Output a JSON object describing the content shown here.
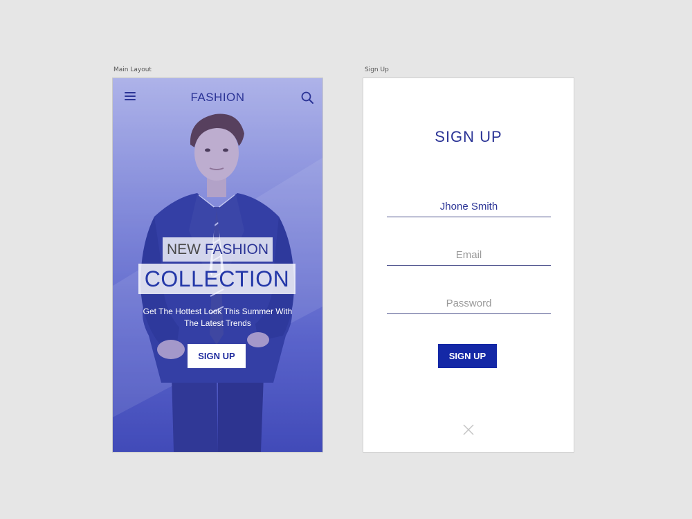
{
  "artboards": {
    "main_label": "Main Layout",
    "signup_label": "Sign Up"
  },
  "main": {
    "menu_icon": "hamburger-menu-icon",
    "brand": "FASHION",
    "search_icon": "search-icon",
    "headline_part1": "NEW ",
    "headline_part2": "FASHION",
    "headline_line2": "COLLECTION",
    "tagline_line1": "Get The Hottest Look This Summer With",
    "tagline_line2": "The Latest Trends",
    "cta_label": "SIGN UP"
  },
  "signup": {
    "title": "SIGN UP",
    "name_value": "Jhone Smith",
    "email_placeholder": "Email",
    "password_placeholder": "Password",
    "button_label": "SIGN UP",
    "close_icon": "close-icon"
  },
  "colors": {
    "brand_blue": "#2b3496",
    "button_blue": "#1428a6",
    "background": "#e6e6e6"
  }
}
